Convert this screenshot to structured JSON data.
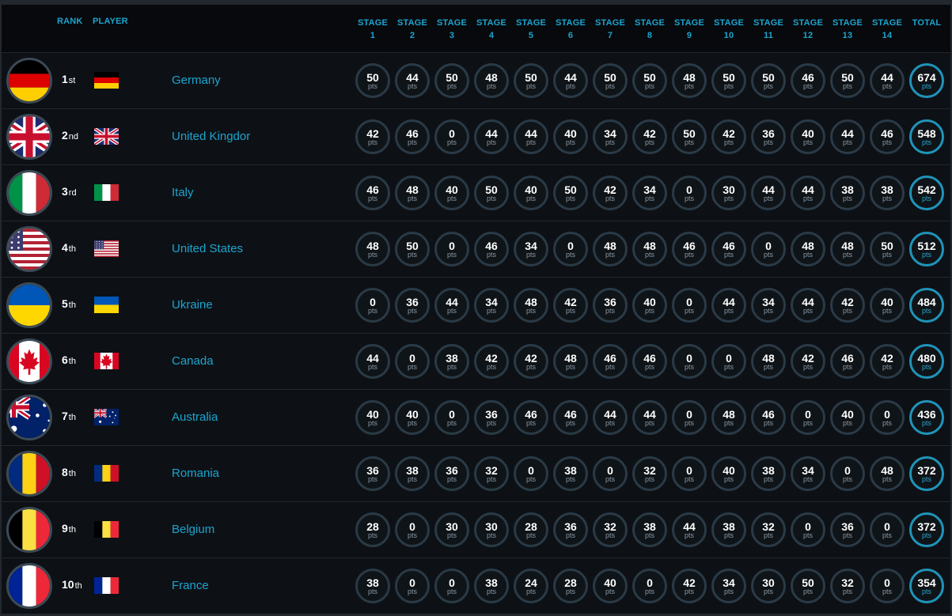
{
  "header": {
    "rank": "RANK",
    "player": "PLAYER",
    "stages": [
      "STAGE 1",
      "STAGE 2",
      "STAGE 3",
      "STAGE 4",
      "STAGE 5",
      "STAGE 6",
      "STAGE 7",
      "STAGE 8",
      "STAGE 9",
      "STAGE 10",
      "STAGE 11",
      "STAGE 12",
      "STAGE 13",
      "STAGE 14"
    ],
    "total": "TOTAL"
  },
  "unit": "pts",
  "rows": [
    {
      "rank": "1",
      "suffix": "st",
      "country": "Germany",
      "flag": "de-flag-icon",
      "scores": [
        "50",
        "44",
        "50",
        "48",
        "50",
        "44",
        "50",
        "50",
        "48",
        "50",
        "50",
        "46",
        "50",
        "44"
      ],
      "total": "674"
    },
    {
      "rank": "2",
      "suffix": "nd",
      "country": "United Kingdor",
      "flag": "gb-flag-icon",
      "scores": [
        "42",
        "46",
        "0",
        "44",
        "44",
        "40",
        "34",
        "42",
        "50",
        "42",
        "36",
        "40",
        "44",
        "46"
      ],
      "total": "548"
    },
    {
      "rank": "3",
      "suffix": "rd",
      "country": "Italy",
      "flag": "it-flag-icon",
      "scores": [
        "46",
        "48",
        "40",
        "50",
        "40",
        "50",
        "42",
        "34",
        "0",
        "30",
        "44",
        "44",
        "38",
        "38"
      ],
      "total": "542"
    },
    {
      "rank": "4",
      "suffix": "th",
      "country": "United States",
      "flag": "us-flag-icon",
      "scores": [
        "48",
        "50",
        "0",
        "46",
        "34",
        "0",
        "48",
        "48",
        "46",
        "46",
        "0",
        "48",
        "48",
        "50"
      ],
      "total": "512"
    },
    {
      "rank": "5",
      "suffix": "th",
      "country": "Ukraine",
      "flag": "ua-flag-icon",
      "scores": [
        "0",
        "36",
        "44",
        "34",
        "48",
        "42",
        "36",
        "40",
        "0",
        "44",
        "34",
        "44",
        "42",
        "40"
      ],
      "total": "484"
    },
    {
      "rank": "6",
      "suffix": "th",
      "country": "Canada",
      "flag": "ca-flag-icon",
      "scores": [
        "44",
        "0",
        "38",
        "42",
        "42",
        "48",
        "46",
        "46",
        "0",
        "0",
        "48",
        "42",
        "46",
        "42"
      ],
      "total": "480"
    },
    {
      "rank": "7",
      "suffix": "th",
      "country": "Australia",
      "flag": "au-flag-icon",
      "scores": [
        "40",
        "40",
        "0",
        "36",
        "46",
        "46",
        "44",
        "44",
        "0",
        "48",
        "46",
        "0",
        "40",
        "0"
      ],
      "total": "436"
    },
    {
      "rank": "8",
      "suffix": "th",
      "country": "Romania",
      "flag": "ro-flag-icon",
      "scores": [
        "36",
        "38",
        "36",
        "32",
        "0",
        "38",
        "0",
        "32",
        "0",
        "40",
        "38",
        "34",
        "0",
        "48"
      ],
      "total": "372"
    },
    {
      "rank": "9",
      "suffix": "th",
      "country": "Belgium",
      "flag": "be-flag-icon",
      "scores": [
        "28",
        "0",
        "30",
        "30",
        "28",
        "36",
        "32",
        "38",
        "44",
        "38",
        "32",
        "0",
        "36",
        "0"
      ],
      "total": "372"
    },
    {
      "rank": "10",
      "suffix": "th",
      "country": "France",
      "flag": "fr-flag-icon",
      "scores": [
        "38",
        "0",
        "0",
        "38",
        "24",
        "28",
        "40",
        "0",
        "42",
        "34",
        "30",
        "50",
        "32",
        "0"
      ],
      "total": "354"
    }
  ],
  "colors": {
    "accent": "#1da4cf",
    "background": "#23282e",
    "row": "#0d1116",
    "header": "#07090c",
    "ring": "#2a3a46",
    "total_ring": "#1f94b9"
  }
}
